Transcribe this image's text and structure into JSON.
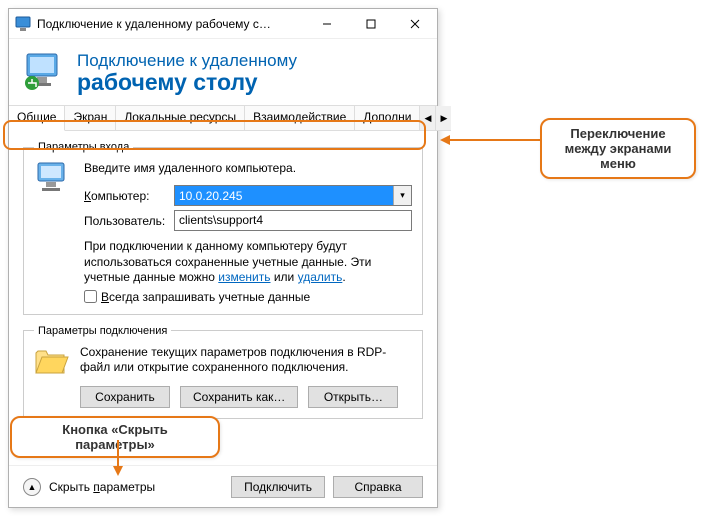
{
  "window": {
    "title": "Подключение к удаленному рабочему с…"
  },
  "header": {
    "line1": "Подключение к удаленному",
    "line2": "рабочему столу"
  },
  "tabs": {
    "items": [
      "Общие",
      "Экран",
      "Локальные ресурсы",
      "Взаимодействие",
      "Дополни"
    ]
  },
  "login": {
    "group_title": "Параметры входа",
    "intro": "Введите имя удаленного компьютера.",
    "computer_label_pre": "К",
    "computer_label_rest": "омпьютер:",
    "computer_value": "10.0.20.245",
    "user_label": "Пользователь:",
    "user_value": "clients\\support4",
    "note_pre": "При подключении к данному компьютеру будут использоваться сохраненные учетные данные.  Эти учетные данные можно ",
    "link_edit": "изменить",
    "note_mid": " или ",
    "link_delete": "удалить",
    "note_post": ".",
    "checkbox_pre": "В",
    "checkbox_rest": "сегда запрашивать учетные данные"
  },
  "conn": {
    "group_title": "Параметры подключения",
    "text": "Сохранение текущих параметров подключения в RDP-файл или открытие сохраненного подключения.",
    "btn_save": "Сохранить",
    "btn_save_as": "Сохранить как…",
    "btn_open": "Открыть…"
  },
  "footer": {
    "hide_pre": "Скрыть ",
    "hide_ul": "п",
    "hide_rest": "араметры",
    "btn_connect": "Подключить",
    "btn_help": "Справка"
  },
  "annotations": {
    "right": "Переключение между экранами меню",
    "bottom": "Кнопка «Скрыть параметры»"
  }
}
